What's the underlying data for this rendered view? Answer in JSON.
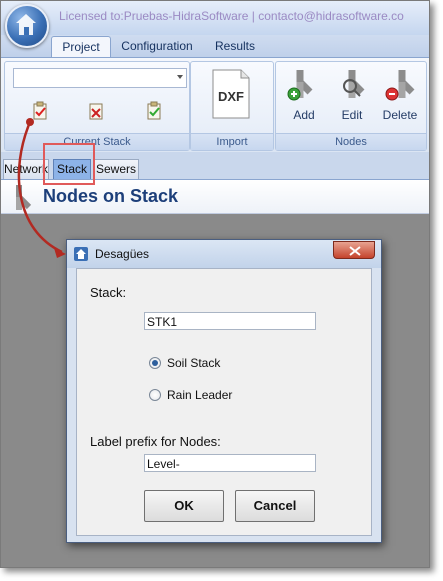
{
  "window": {
    "title": "Licensed to:Pruebas-HidraSoftware  |  contacto@hidrasoftware.co"
  },
  "ribbon": {
    "tabs": [
      {
        "label": "Project",
        "active": true
      },
      {
        "label": "Configuration",
        "active": false
      },
      {
        "label": "Results",
        "active": false
      }
    ],
    "groups": {
      "current_stack": {
        "label": "Current Stack",
        "combo_value": ""
      },
      "import": {
        "label": "Import",
        "dxf_label": "DXF"
      },
      "nodes": {
        "label": "Nodes",
        "add": "Add",
        "edit": "Edit",
        "delete": "Delete"
      }
    }
  },
  "doc_tabs": [
    {
      "label": "Network",
      "active": false
    },
    {
      "label": "Stack",
      "active": true
    },
    {
      "label": "Sewers",
      "active": false
    }
  ],
  "page": {
    "title": "Nodes on Stack"
  },
  "dialog": {
    "title": "Desagües",
    "stack_label": "Stack:",
    "stack_value": "STK1",
    "radio_soil": "Soil Stack",
    "radio_rain": "Rain Leader",
    "selected": "Soil Stack",
    "prefix_label": "Label prefix for Nodes:",
    "prefix_value": "Level-",
    "ok": "OK",
    "cancel": "Cancel"
  },
  "colors": {
    "annotation": "#c0392b",
    "header_title": "#1d3f7a",
    "ribbon_text": "#15315f"
  }
}
